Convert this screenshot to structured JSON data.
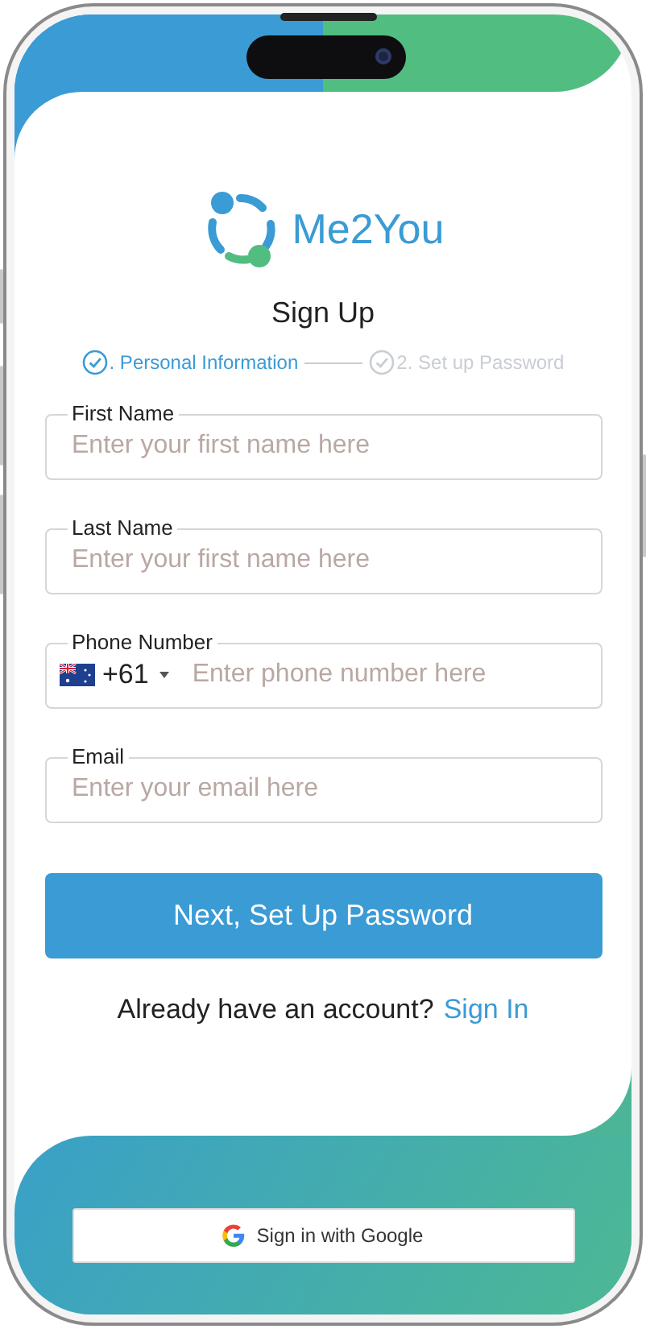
{
  "app": {
    "logo_text": "Me2You",
    "title": "Sign Up"
  },
  "steps": [
    {
      "label": ". Personal Information",
      "selected": true
    },
    {
      "label": "2. Set up Password",
      "selected": false
    }
  ],
  "fields": [
    {
      "kind": "text",
      "label": "First Name",
      "placeholder": "Enter your first name here"
    },
    {
      "kind": "text",
      "label": "Last Name",
      "placeholder": "Enter your first name here"
    },
    {
      "kind": "phone",
      "label": "Phone Number",
      "country_code": "+61",
      "placeholder": "Enter phone number here"
    },
    {
      "kind": "text",
      "label": "Email",
      "placeholder": "Enter your email here"
    }
  ],
  "primary_button": "Next, Set Up Password",
  "signin_prompt": {
    "text": "Already have an account?",
    "link": "Sign In"
  },
  "google_button": "Sign in with Google"
}
